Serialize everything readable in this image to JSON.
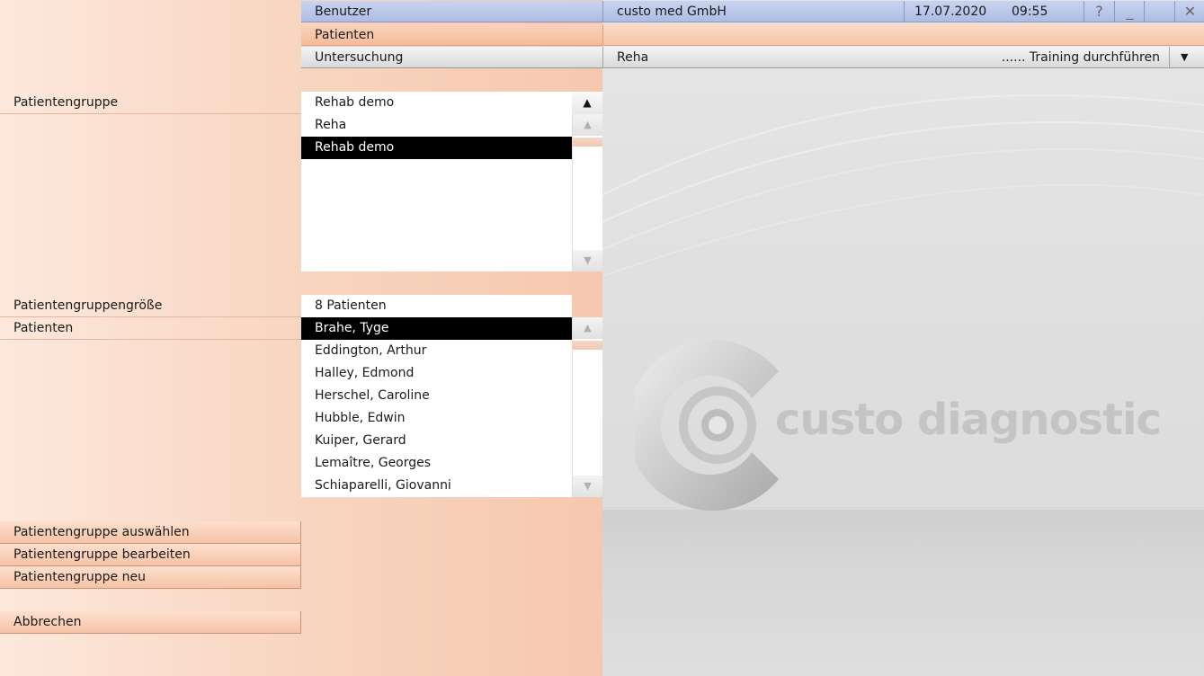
{
  "header": {
    "user_label": "Benutzer",
    "company": "custo med GmbH",
    "date": "17.07.2020",
    "time": "09:55",
    "help_glyph": "?",
    "minimize_glyph": "_",
    "close_glyph": "✕",
    "patients_label": "Patienten",
    "exam_label": "Untersuchung",
    "exam_type": "Reha",
    "exam_action": "...... Training durchführen",
    "dropdown_glyph": "▼"
  },
  "form": {
    "group_label": "Patientengruppe",
    "group_value": "Rehab demo",
    "group_options": [
      "Reha",
      "Rehab demo"
    ],
    "group_selected": 1,
    "size_label": "Patientengruppengröße",
    "size_value": "8 Patienten",
    "patients_label": "Patienten",
    "patients": [
      "Brahe, Tyge",
      "Eddington, Arthur",
      "Halley, Edmond",
      "Herschel, Caroline",
      "Hubble, Edwin",
      "Kuiper, Gerard",
      "Lemaître, Georges",
      "Schiaparelli, Giovanni"
    ],
    "patients_selected": 0
  },
  "actions": {
    "select": "Patientengruppe auswählen",
    "edit": "Patientengruppe bearbeiten",
    "new": "Patientengruppe neu",
    "cancel": "Abbrechen"
  },
  "brand": {
    "logo_text": "custo diagnostic",
    "icons": [
      "up-arrow-icon",
      "down-arrow-icon",
      "help-icon",
      "minimize-icon",
      "close-icon",
      "dropdown-arrow-icon",
      "custo-logo-icon"
    ]
  },
  "colors": {
    "accent_peach": "#f5c8ae",
    "header_blue": "#aebce3",
    "selection": "#000000"
  }
}
